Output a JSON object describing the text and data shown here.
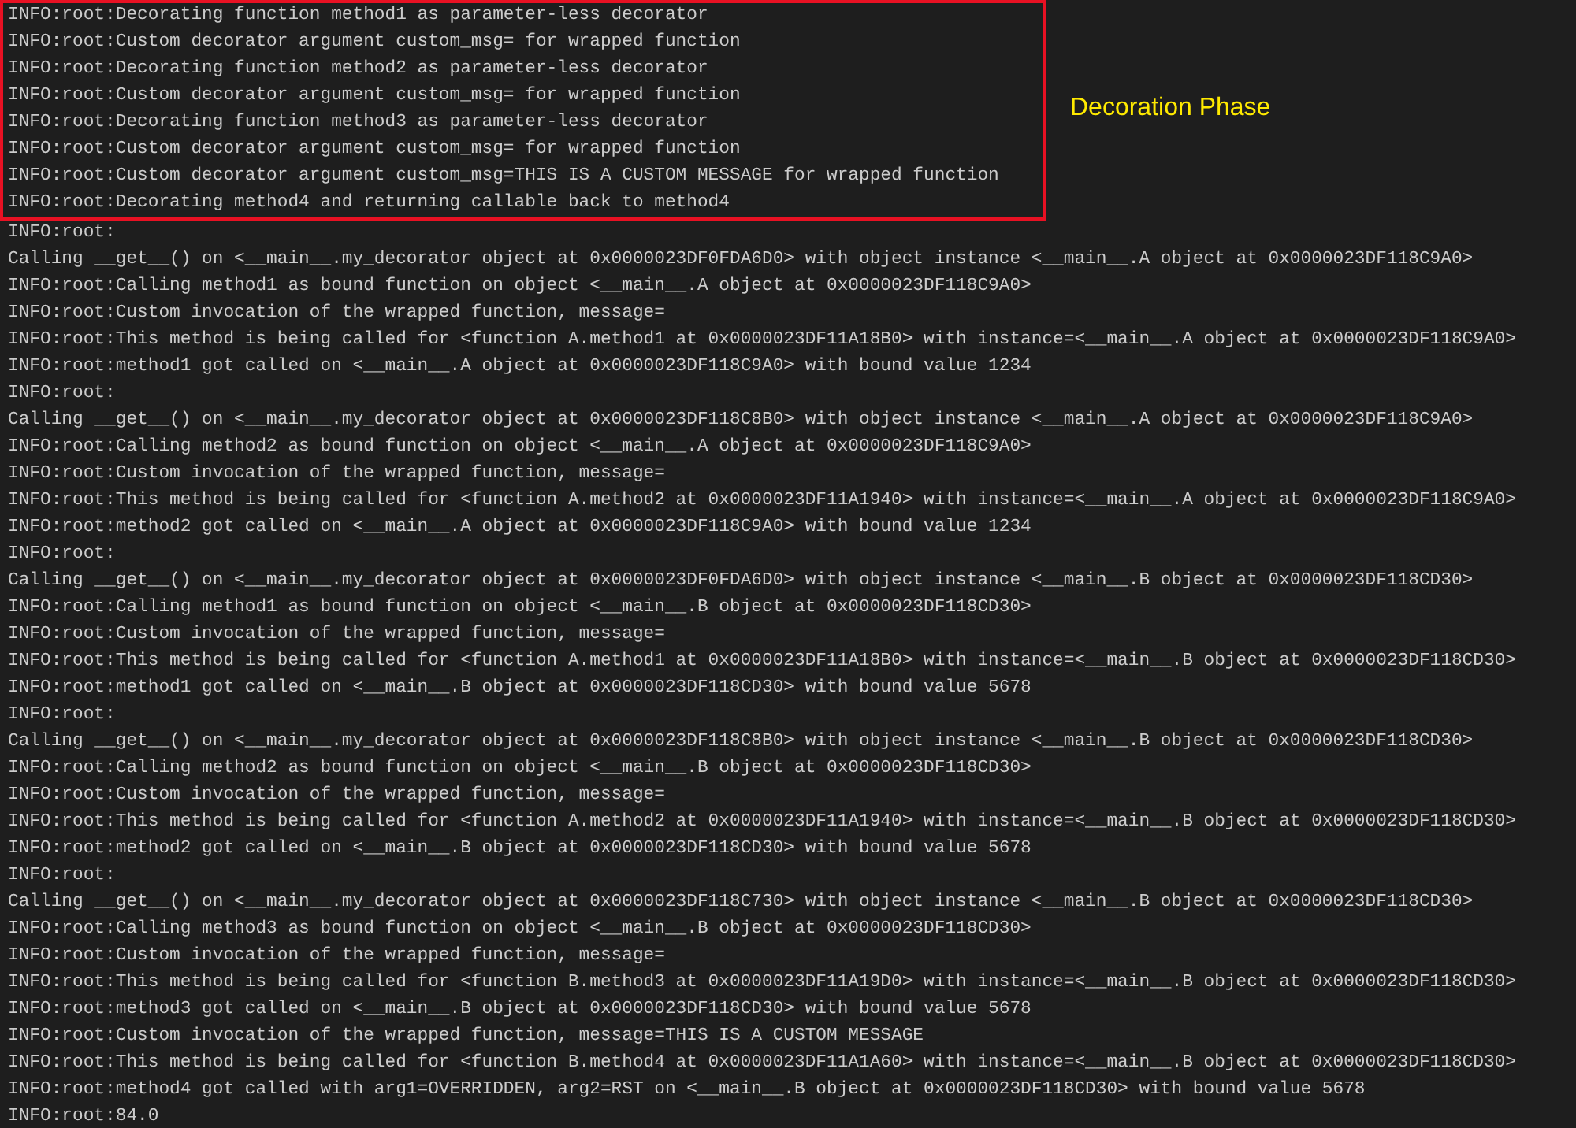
{
  "highlighted_block": {
    "lines": [
      "INFO:root:Decorating function method1 as parameter-less decorator",
      "INFO:root:Custom decorator argument custom_msg= for wrapped function",
      "INFO:root:Decorating function method2 as parameter-less decorator",
      "INFO:root:Custom decorator argument custom_msg= for wrapped function",
      "INFO:root:Decorating function method3 as parameter-less decorator",
      "INFO:root:Custom decorator argument custom_msg= for wrapped function",
      "INFO:root:Custom decorator argument custom_msg=THIS IS A CUSTOM MESSAGE for wrapped function",
      "INFO:root:Decorating method4 and returning callable back to method4"
    ],
    "annotation": "Decoration Phase"
  },
  "log_lines": [
    "INFO:root:",
    "Calling __get__() on <__main__.my_decorator object at 0x0000023DF0FDA6D0> with object instance <__main__.A object at 0x0000023DF118C9A0>",
    "INFO:root:Calling method1 as bound function on object <__main__.A object at 0x0000023DF118C9A0>",
    "INFO:root:Custom invocation of the wrapped function, message=",
    "INFO:root:This method is being called for <function A.method1 at 0x0000023DF11A18B0> with instance=<__main__.A object at 0x0000023DF118C9A0>",
    "INFO:root:method1 got called on <__main__.A object at 0x0000023DF118C9A0> with bound value 1234",
    "INFO:root:",
    "Calling __get__() on <__main__.my_decorator object at 0x0000023DF118C8B0> with object instance <__main__.A object at 0x0000023DF118C9A0>",
    "INFO:root:Calling method2 as bound function on object <__main__.A object at 0x0000023DF118C9A0>",
    "INFO:root:Custom invocation of the wrapped function, message=",
    "INFO:root:This method is being called for <function A.method2 at 0x0000023DF11A1940> with instance=<__main__.A object at 0x0000023DF118C9A0>",
    "INFO:root:method2 got called on <__main__.A object at 0x0000023DF118C9A0> with bound value 1234",
    "INFO:root:",
    "Calling __get__() on <__main__.my_decorator object at 0x0000023DF0FDA6D0> with object instance <__main__.B object at 0x0000023DF118CD30>",
    "INFO:root:Calling method1 as bound function on object <__main__.B object at 0x0000023DF118CD30>",
    "INFO:root:Custom invocation of the wrapped function, message=",
    "INFO:root:This method is being called for <function A.method1 at 0x0000023DF11A18B0> with instance=<__main__.B object at 0x0000023DF118CD30>",
    "INFO:root:method1 got called on <__main__.B object at 0x0000023DF118CD30> with bound value 5678",
    "INFO:root:",
    "Calling __get__() on <__main__.my_decorator object at 0x0000023DF118C8B0> with object instance <__main__.B object at 0x0000023DF118CD30>",
    "INFO:root:Calling method2 as bound function on object <__main__.B object at 0x0000023DF118CD30>",
    "INFO:root:Custom invocation of the wrapped function, message=",
    "INFO:root:This method is being called for <function A.method2 at 0x0000023DF11A1940> with instance=<__main__.B object at 0x0000023DF118CD30>",
    "INFO:root:method2 got called on <__main__.B object at 0x0000023DF118CD30> with bound value 5678",
    "INFO:root:",
    "Calling __get__() on <__main__.my_decorator object at 0x0000023DF118C730> with object instance <__main__.B object at 0x0000023DF118CD30>",
    "INFO:root:Calling method3 as bound function on object <__main__.B object at 0x0000023DF118CD30>",
    "INFO:root:Custom invocation of the wrapped function, message=",
    "INFO:root:This method is being called for <function B.method3 at 0x0000023DF11A19D0> with instance=<__main__.B object at 0x0000023DF118CD30>",
    "INFO:root:method3 got called on <__main__.B object at 0x0000023DF118CD30> with bound value 5678",
    "INFO:root:Custom invocation of the wrapped function, message=THIS IS A CUSTOM MESSAGE",
    "INFO:root:This method is being called for <function B.method4 at 0x0000023DF11A1A60> with instance=<__main__.B object at 0x0000023DF118CD30>",
    "INFO:root:method4 got called with arg1=OVERRIDDEN, arg2=RST on <__main__.B object at 0x0000023DF118CD30> with bound value 5678",
    "INFO:root:84.0"
  ]
}
